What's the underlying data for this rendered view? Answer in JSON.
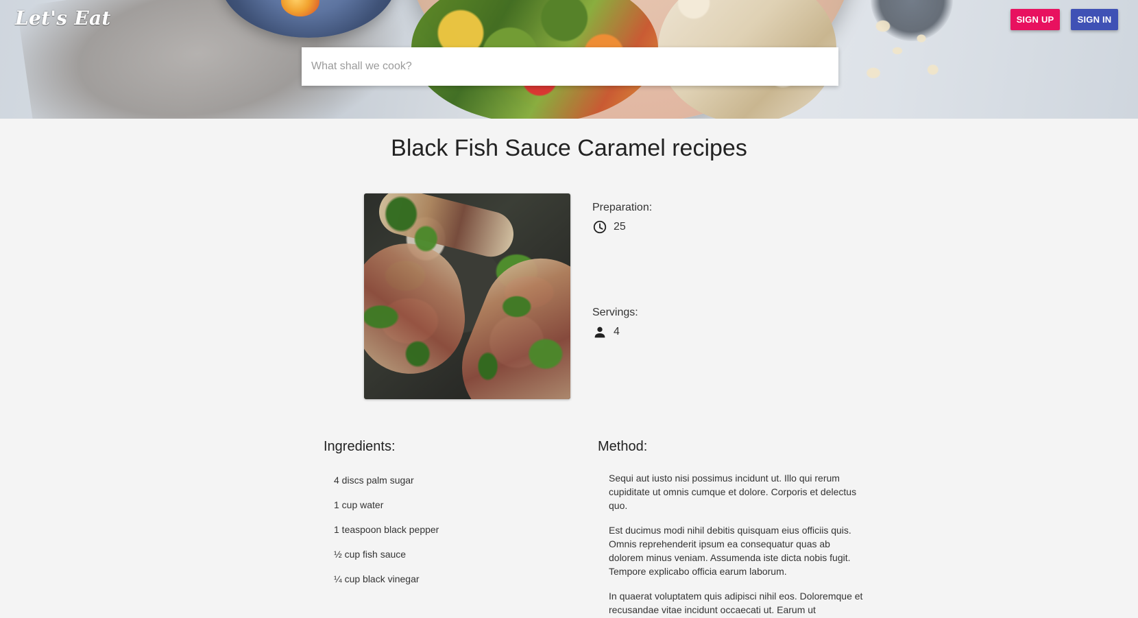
{
  "header": {
    "logo_text": "Let's Eat",
    "signup_label": "SIGN UP",
    "signin_label": "SIGN IN",
    "search": {
      "placeholder": "What shall we cook?",
      "value": ""
    }
  },
  "recipe": {
    "title": "Black Fish Sauce Caramel recipes",
    "preparation_label": "Preparation:",
    "preparation_value": "25",
    "servings_label": "Servings:",
    "servings_value": "4",
    "ingredients_title": "Ingredients:",
    "ingredients": [
      "4 discs palm sugar",
      "1 cup water",
      "1 teaspoon black pepper",
      "½ cup fish sauce",
      "¼ cup black vinegar"
    ],
    "method_title": "Method:",
    "method": [
      "Sequi aut iusto nisi possimus incidunt ut. Illo qui rerum cupiditate ut omnis cumque et dolore. Corporis et delectus quo.",
      "Est ducimus modi nihil debitis quisquam eius officiis quis. Omnis reprehenderit ipsum ea consequatur quas ab dolorem minus veniam. Assumenda iste dicta nobis fugit. Tempore explicabo officia earum laborum.",
      "In quaerat voluptatem quis adipisci nihil eos. Doloremque et recusandae vitae incidunt occaecati ut. Earum ut"
    ]
  },
  "colors": {
    "signup_button": "#e8115f",
    "signin_button": "#3f51b5",
    "page_background": "#f4f4f4"
  },
  "icons": {
    "preparation": "clock-icon",
    "servings": "person-icon"
  }
}
